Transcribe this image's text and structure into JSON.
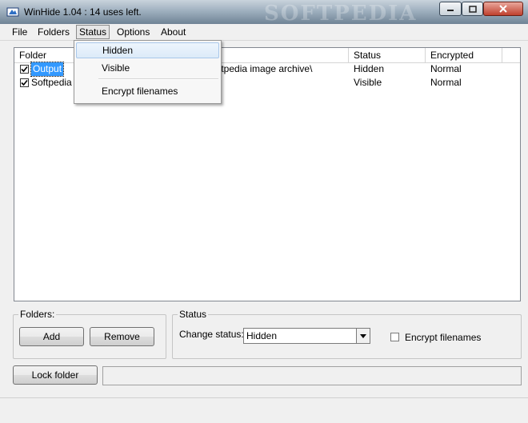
{
  "window": {
    "title": "WinHide 1.04 : 14 uses left.",
    "watermark": "SOFTPEDIA"
  },
  "menubar": {
    "items": [
      "File",
      "Folders",
      "Status",
      "Options",
      "About"
    ],
    "active": "Status"
  },
  "status_menu": {
    "items": [
      "Hidden",
      "Visible",
      "Encrypt filenames"
    ],
    "highlighted": "Hidden"
  },
  "listview": {
    "columns": [
      "Folder",
      "Status",
      "Encrypted"
    ],
    "rows": [
      {
        "folder": "Output",
        "path_fragment": "ftpedia image archive\\",
        "status": "Hidden",
        "encrypted": "Normal",
        "checked": true
      },
      {
        "folder": "Softpedia te",
        "path_fragment": "",
        "status": "Visible",
        "encrypted": "Normal",
        "checked": true
      }
    ]
  },
  "folders_group": {
    "label": "Folders:",
    "add_label": "Add",
    "remove_label": "Remove"
  },
  "status_group": {
    "label": "Status",
    "change_label": "Change status:",
    "selected": "Hidden",
    "encrypt_label": "Encrypt filenames"
  },
  "lock_button": "Lock folder",
  "colors": {
    "selection": "#3399ff",
    "menu_highlight": "#dceaf8",
    "close_button": "#c0402e"
  }
}
